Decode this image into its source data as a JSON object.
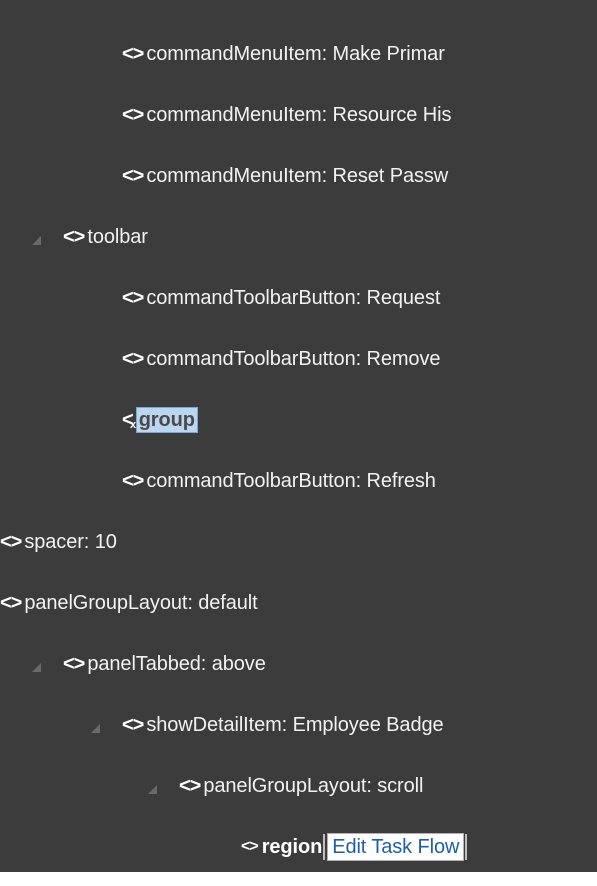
{
  "tree": {
    "rows": [
      {
        "label": "commandMenuItem: Make Primar"
      },
      {
        "label": "commandMenuItem: Resource His"
      },
      {
        "label": "commandMenuItem: Reset Passw"
      },
      {
        "label": "toolbar"
      },
      {
        "label": "commandToolbarButton: Request"
      },
      {
        "label": "commandToolbarButton: Remove"
      },
      {
        "label": "group"
      },
      {
        "label": "commandToolbarButton: Refresh"
      },
      {
        "label": "spacer: 10"
      },
      {
        "label": "panelGroupLayout: default"
      },
      {
        "label": "panelTabbed: above"
      },
      {
        "label": "showDetailItem: Employee Badge"
      },
      {
        "label": "panelGroupLayout: scroll"
      },
      {
        "label": "region",
        "edit_link": "Edit Task Flow"
      }
    ]
  }
}
